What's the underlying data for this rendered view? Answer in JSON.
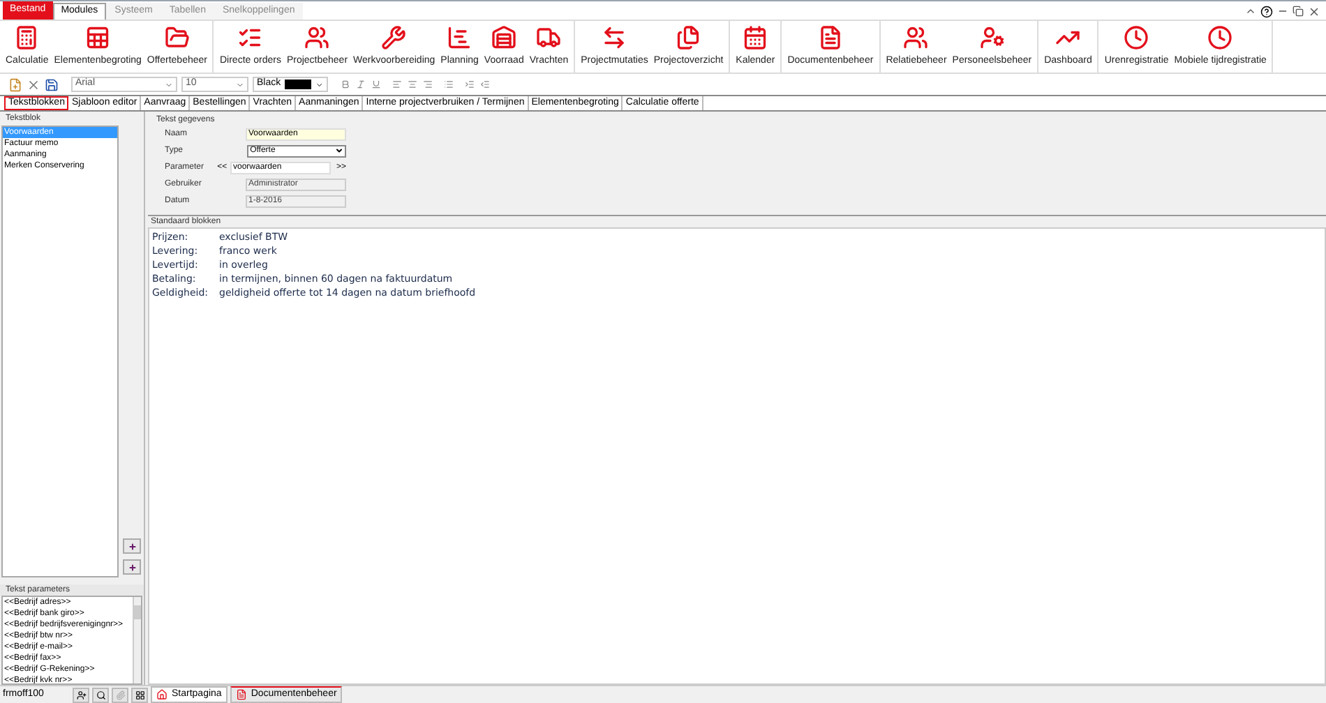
{
  "menu": [
    {
      "label": "Bestand",
      "kind": "file"
    },
    {
      "label": "Modules",
      "kind": "tab",
      "selected": true
    },
    {
      "label": "Systeem",
      "kind": "tab",
      "selected": false
    },
    {
      "label": "Tabellen",
      "kind": "tab",
      "selected": false
    },
    {
      "label": "Snelkoppelingen",
      "kind": "tab",
      "selected": false
    }
  ],
  "ribbon_groups": [
    [
      {
        "label": "Calculatie",
        "kind": "calculator"
      },
      {
        "label": "Elementenbegroting",
        "kind": "sheets"
      },
      {
        "label": "Offertebeheer",
        "kind": "folder"
      }
    ],
    [
      {
        "label": "Directe orders",
        "kind": "list"
      },
      {
        "label": "Projectbeheer",
        "kind": "people"
      },
      {
        "label": "Werkvoorbereiding",
        "kind": "tools"
      },
      {
        "label": "Planning",
        "kind": "chart"
      },
      {
        "label": "Voorraad",
        "kind": "warehouse"
      },
      {
        "label": "Vrachten",
        "kind": "truck"
      }
    ],
    [
      {
        "label": "Projectmutaties",
        "kind": "swap"
      },
      {
        "label": "Projectoverzicht",
        "kind": "files"
      }
    ],
    [
      {
        "label": "Kalender",
        "kind": "calendar"
      }
    ],
    [
      {
        "label": "Documentenbeheer",
        "kind": "document"
      }
    ],
    [
      {
        "label": "Relatiebeheer",
        "kind": "people"
      },
      {
        "label": "Personeelsbeheer",
        "kind": "staff"
      }
    ],
    [
      {
        "label": "Dashboard",
        "kind": "chart-up"
      }
    ],
    [
      {
        "label": "Urenregistratie",
        "kind": "clock"
      },
      {
        "label": "Mobiele tijdregistratie",
        "kind": "clock"
      }
    ]
  ],
  "toolbar": {
    "font": "Arial",
    "size": "10",
    "color_name": "Black",
    "color": "#000000"
  },
  "tabs": [
    {
      "label": "Tekstblokken",
      "selected": true
    },
    {
      "label": "Sjabloon editor",
      "selected": false
    },
    {
      "label": "Aanvraag",
      "selected": false
    },
    {
      "label": "Bestellingen",
      "selected": false
    },
    {
      "label": "Vrachten",
      "selected": false
    },
    {
      "label": "Aanmaningen",
      "selected": false
    },
    {
      "label": "Interne projectverbruiken / Termijnen",
      "selected": false
    },
    {
      "label": "Elementenbegroting",
      "selected": false
    },
    {
      "label": "Calculatie offerte",
      "selected": false
    }
  ],
  "tekstblok": {
    "title": "Tekstblok",
    "items": [
      {
        "label": "Voorwaarden",
        "selected": true
      },
      {
        "label": "Factuur memo",
        "selected": false
      },
      {
        "label": "Aanmaning",
        "selected": false
      },
      {
        "label": "Merken Conservering",
        "selected": false
      }
    ]
  },
  "tekst_parameters": {
    "title": "Tekst parameters",
    "items": [
      "<<Bedrijf adres>>",
      "<<Bedrijf bank giro>>",
      "<<Bedrijf bedrijfsverenigingnr>>",
      "<<Bedrijf btw nr>>",
      "<<Bedrijf e-mail>>",
      "<<Bedrijf fax>>",
      "<<Bedrijf G-Rekening>>",
      "<<Bedrijf kvk nr>>"
    ]
  },
  "tekst_gegevens": {
    "title": "Tekst gegevens",
    "fields": [
      {
        "label": "Naam",
        "kind": "highlight",
        "value": "Voorwaarden"
      },
      {
        "label": "Type",
        "kind": "select",
        "value": "Offerte"
      },
      {
        "label": "Parameter",
        "kind": "param",
        "prev": "<<",
        "value": "voorwaarden",
        "next": ">>"
      },
      {
        "label": "Gebruiker",
        "kind": "readonly",
        "value": "Administrator"
      },
      {
        "label": "Datum",
        "kind": "readonly",
        "value": "1-8-2016"
      }
    ]
  },
  "standaard_blokken": {
    "title": "Standaard blokken",
    "rows": [
      {
        "label": "Prijzen:",
        "value": "exclusief BTW"
      },
      {
        "label": "Levering:",
        "value": "franco werk"
      },
      {
        "label": "Levertijd:",
        "value": "in overleg"
      },
      {
        "label": "Betaling:",
        "value": "in termijnen, binnen 60 dagen na faktuurdatum"
      },
      {
        "label": "Geldigheid:",
        "value": "geldigheid offerte tot 14 dagen na datum briefhoofd"
      }
    ]
  },
  "status_bar": {
    "form": "frmoff100",
    "tasks": [
      {
        "label": "Startpagina",
        "selected": false
      },
      {
        "label": "Documentenbeheer",
        "selected": true
      }
    ]
  }
}
